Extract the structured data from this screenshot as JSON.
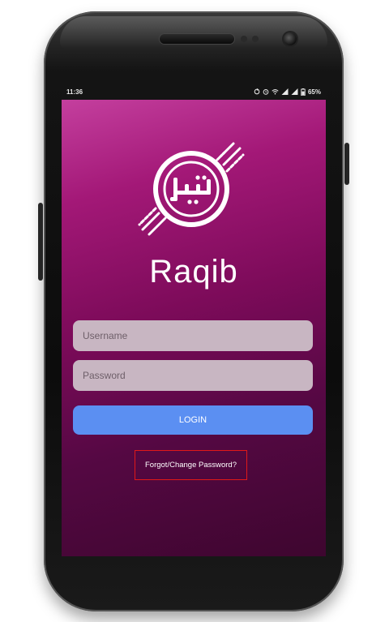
{
  "status_bar": {
    "time": "11:36",
    "battery": "65%",
    "icons": [
      "sync-icon",
      "alarm-icon",
      "wifi-icon",
      "signal-icon",
      "signal-icon",
      "battery-icon"
    ]
  },
  "app": {
    "brand_name": "Raqib",
    "logo_icon": "raqib-logo-icon"
  },
  "form": {
    "username_placeholder": "Username",
    "password_placeholder": "Password",
    "login_label": "LOGIN",
    "forgot_label": "Forgot/Change Password?"
  },
  "colors": {
    "gradient_top": "#c43f9e",
    "gradient_bottom": "#3e062f",
    "input_bg": "#c8b6c2",
    "login_button": "#5b8ff2",
    "highlight_box": "#e01818"
  }
}
